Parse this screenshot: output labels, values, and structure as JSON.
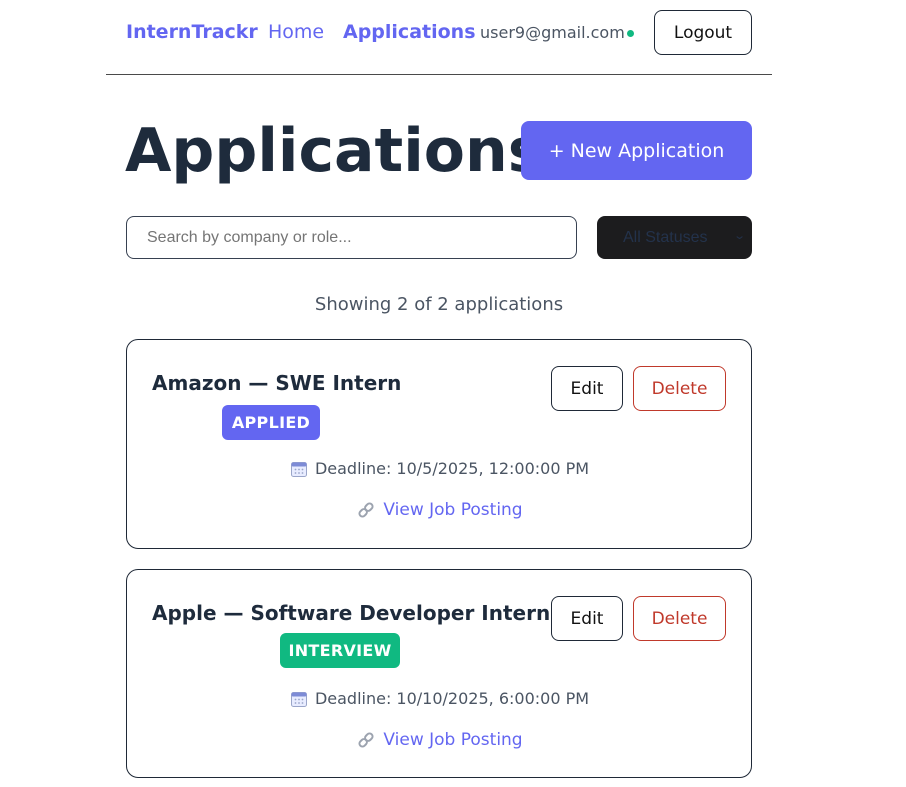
{
  "nav": {
    "brand": "InternTrackr",
    "home": "Home",
    "applications": "Applications",
    "user_email": "user9@gmail.com",
    "logout": "Logout"
  },
  "page": {
    "title": "Applications",
    "new_button": "+ New Application"
  },
  "filters": {
    "search_placeholder": "Search by company or role...",
    "status_selected": "All Statuses"
  },
  "summary": "Showing 2 of 2 applications",
  "applications": [
    {
      "title": "Amazon — SWE Intern",
      "status": "APPLIED",
      "deadline": "Deadline: 10/5/2025, 12:00:00 PM",
      "link": "View Job Posting",
      "edit": "Edit",
      "delete": "Delete"
    },
    {
      "title": "Apple — Software Developer Intern",
      "status": "INTERVIEW",
      "deadline": "Deadline: 10/10/2025, 6:00:00 PM",
      "link": "View Job Posting",
      "edit": "Edit",
      "delete": "Delete"
    }
  ],
  "colors": {
    "accent": "#6366f1",
    "applied": "#6366f1",
    "interview": "#10b981",
    "danger": "#c0392b",
    "online": "#10b981"
  },
  "icons": {
    "calendar": "calendar-icon",
    "link": "link-icon"
  }
}
